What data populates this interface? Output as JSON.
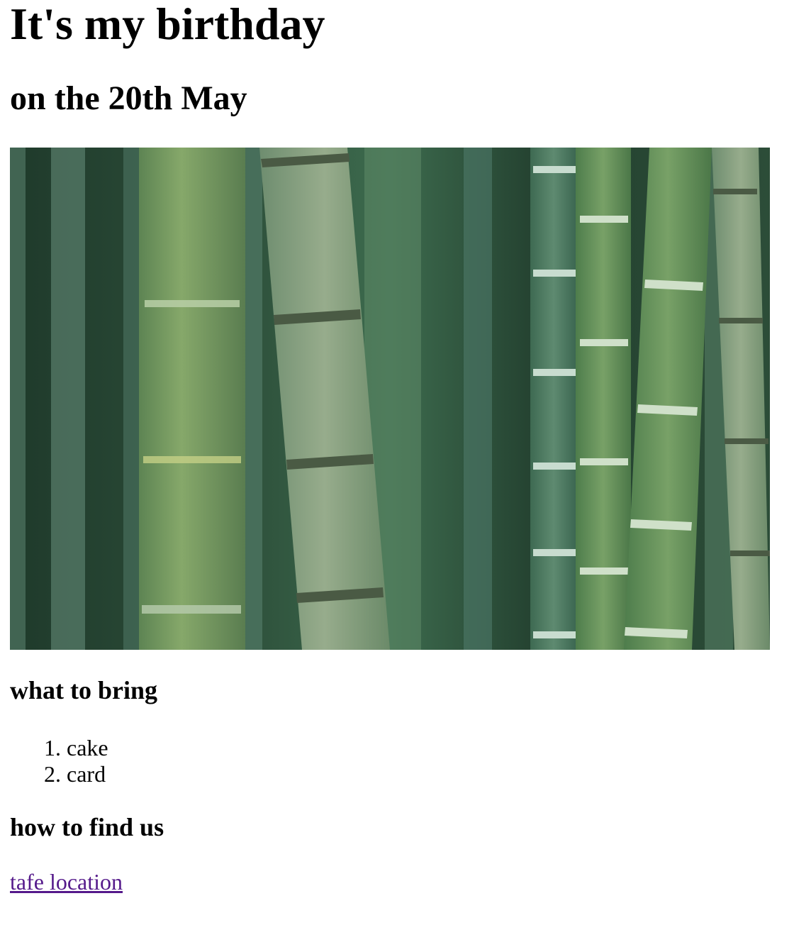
{
  "header": {
    "title": "It's my birthday",
    "subtitle": "on the 20th May"
  },
  "hero_image": {
    "subject": "bamboo-forest-photo"
  },
  "bring": {
    "heading": "what to bring",
    "items": [
      "cake",
      "card"
    ]
  },
  "find": {
    "heading": "how to find us",
    "link_label": "tafe location"
  },
  "colors": {
    "link_visited": "#551a8b",
    "text": "#000000",
    "background": "#ffffff"
  }
}
